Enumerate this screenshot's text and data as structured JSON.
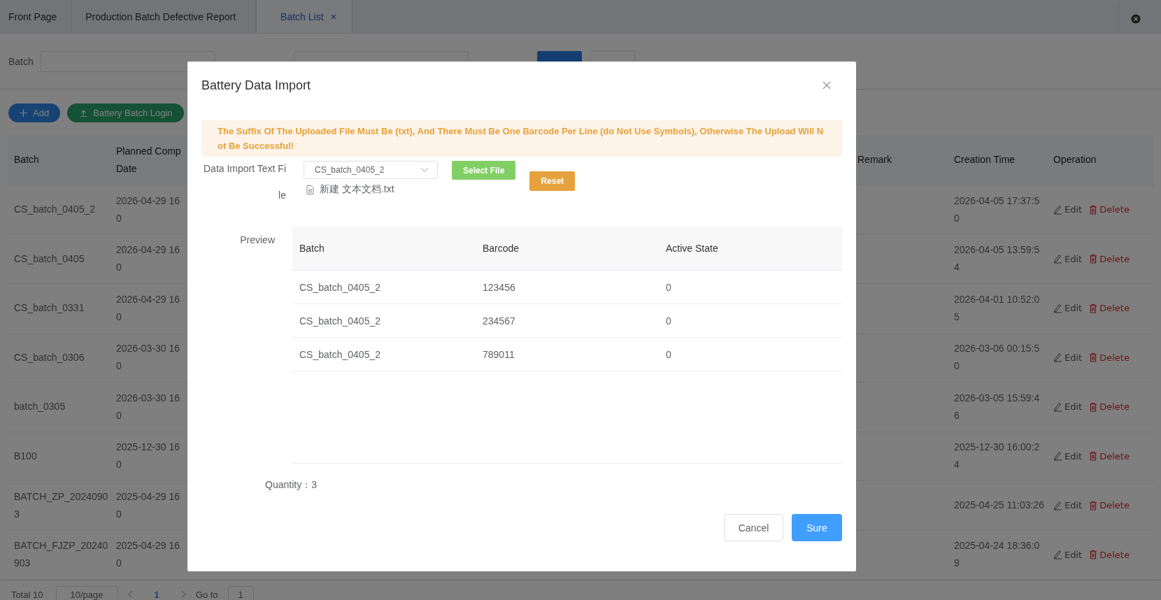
{
  "tabs": [
    {
      "label": "Front Page",
      "selected": false,
      "closable": false
    },
    {
      "label": "Production Batch Defective Report",
      "selected": false,
      "closable": false
    },
    {
      "label": "Batch List",
      "selected": true,
      "closable": true
    }
  ],
  "filters": {
    "batch_label": "Batch"
  },
  "actions": [
    {
      "label": "Add",
      "kind": "add"
    },
    {
      "label": "Battery Batch Login",
      "kind": "upload"
    }
  ],
  "table": {
    "columns": [
      "Batch",
      "Planned Comp\nDate",
      "Remark",
      "Creation Time",
      "Operation"
    ],
    "rows": [
      {
        "batch": "CS_batch_0405_2",
        "planned": "2026-04-29 16\n0",
        "created": "2026-04-05 17:37:5\n0",
        "edit": "Edit",
        "delete": "Delete"
      },
      {
        "batch": "CS_batch_0405",
        "planned": "2026-04-29 16\n0",
        "created": "2026-04-05 13:59:5\n4",
        "edit": "Edit",
        "delete": "Delete"
      },
      {
        "batch": "CS_batch_0331",
        "planned": "2026-04-29 16\n0",
        "created": "2026-04-01 10:52:0\n5",
        "edit": "Edit",
        "delete": "Delete"
      },
      {
        "batch": "CS_batch_0306",
        "planned": "2026-03-30 16\n0",
        "created": "2026-03-06 00:15:5\n0",
        "edit": "Edit",
        "delete": "Delete"
      },
      {
        "batch": "batch_0305",
        "planned": "2026-03-30 16\n0",
        "created": "2026-03-05 15:59:4\n6",
        "edit": "Edit",
        "delete": "Delete"
      },
      {
        "batch": "B100",
        "planned": "2025-12-30 16\n0",
        "created": "2025-12-30 16:00:2\n4",
        "edit": "Edit",
        "delete": "Delete"
      },
      {
        "batch": "BATCH_ZP_2024090\n3",
        "planned": "2025-04-29 16\n0",
        "created": "2025-04-25 11:03:26",
        "edit": "Edit",
        "delete": "Delete"
      },
      {
        "batch": "BATCH_FJZP_20240\n903",
        "planned": "2025-04-29 16\n0",
        "created": "2025-04-24 18:36:0\n9",
        "edit": "Edit",
        "delete": "Delete"
      }
    ]
  },
  "pagination": {
    "total": "Total 10",
    "page_size": "10/page",
    "page": "1",
    "goto_label": "Go to",
    "goto_value": "1"
  },
  "dialog": {
    "title": "Battery Data Import",
    "warning": "The Suffix Of The Uploaded File Must Be (txt), And There Must Be One Barcode Per Line (do Not Use Symbols), Otherwise The Upload Will Not Be Successful!",
    "file_label": "Data Import Text Fi\nle",
    "batch_select": "CS_batch_0405_2",
    "select_file": "Select File",
    "reset": "Reset",
    "file_name": "新建 文本文档.txt",
    "preview_label": "Preview",
    "preview": {
      "columns": [
        "Batch",
        "Barcode",
        "Active State"
      ],
      "rows": [
        [
          "CS_batch_0405_2",
          "123456",
          "0"
        ],
        [
          "CS_batch_0405_2",
          "234567",
          "0"
        ],
        [
          "CS_batch_0405_2",
          "789011",
          "0"
        ]
      ]
    },
    "quantity": "Quantity：3",
    "cancel": "Cancel",
    "confirm": "Sure"
  }
}
